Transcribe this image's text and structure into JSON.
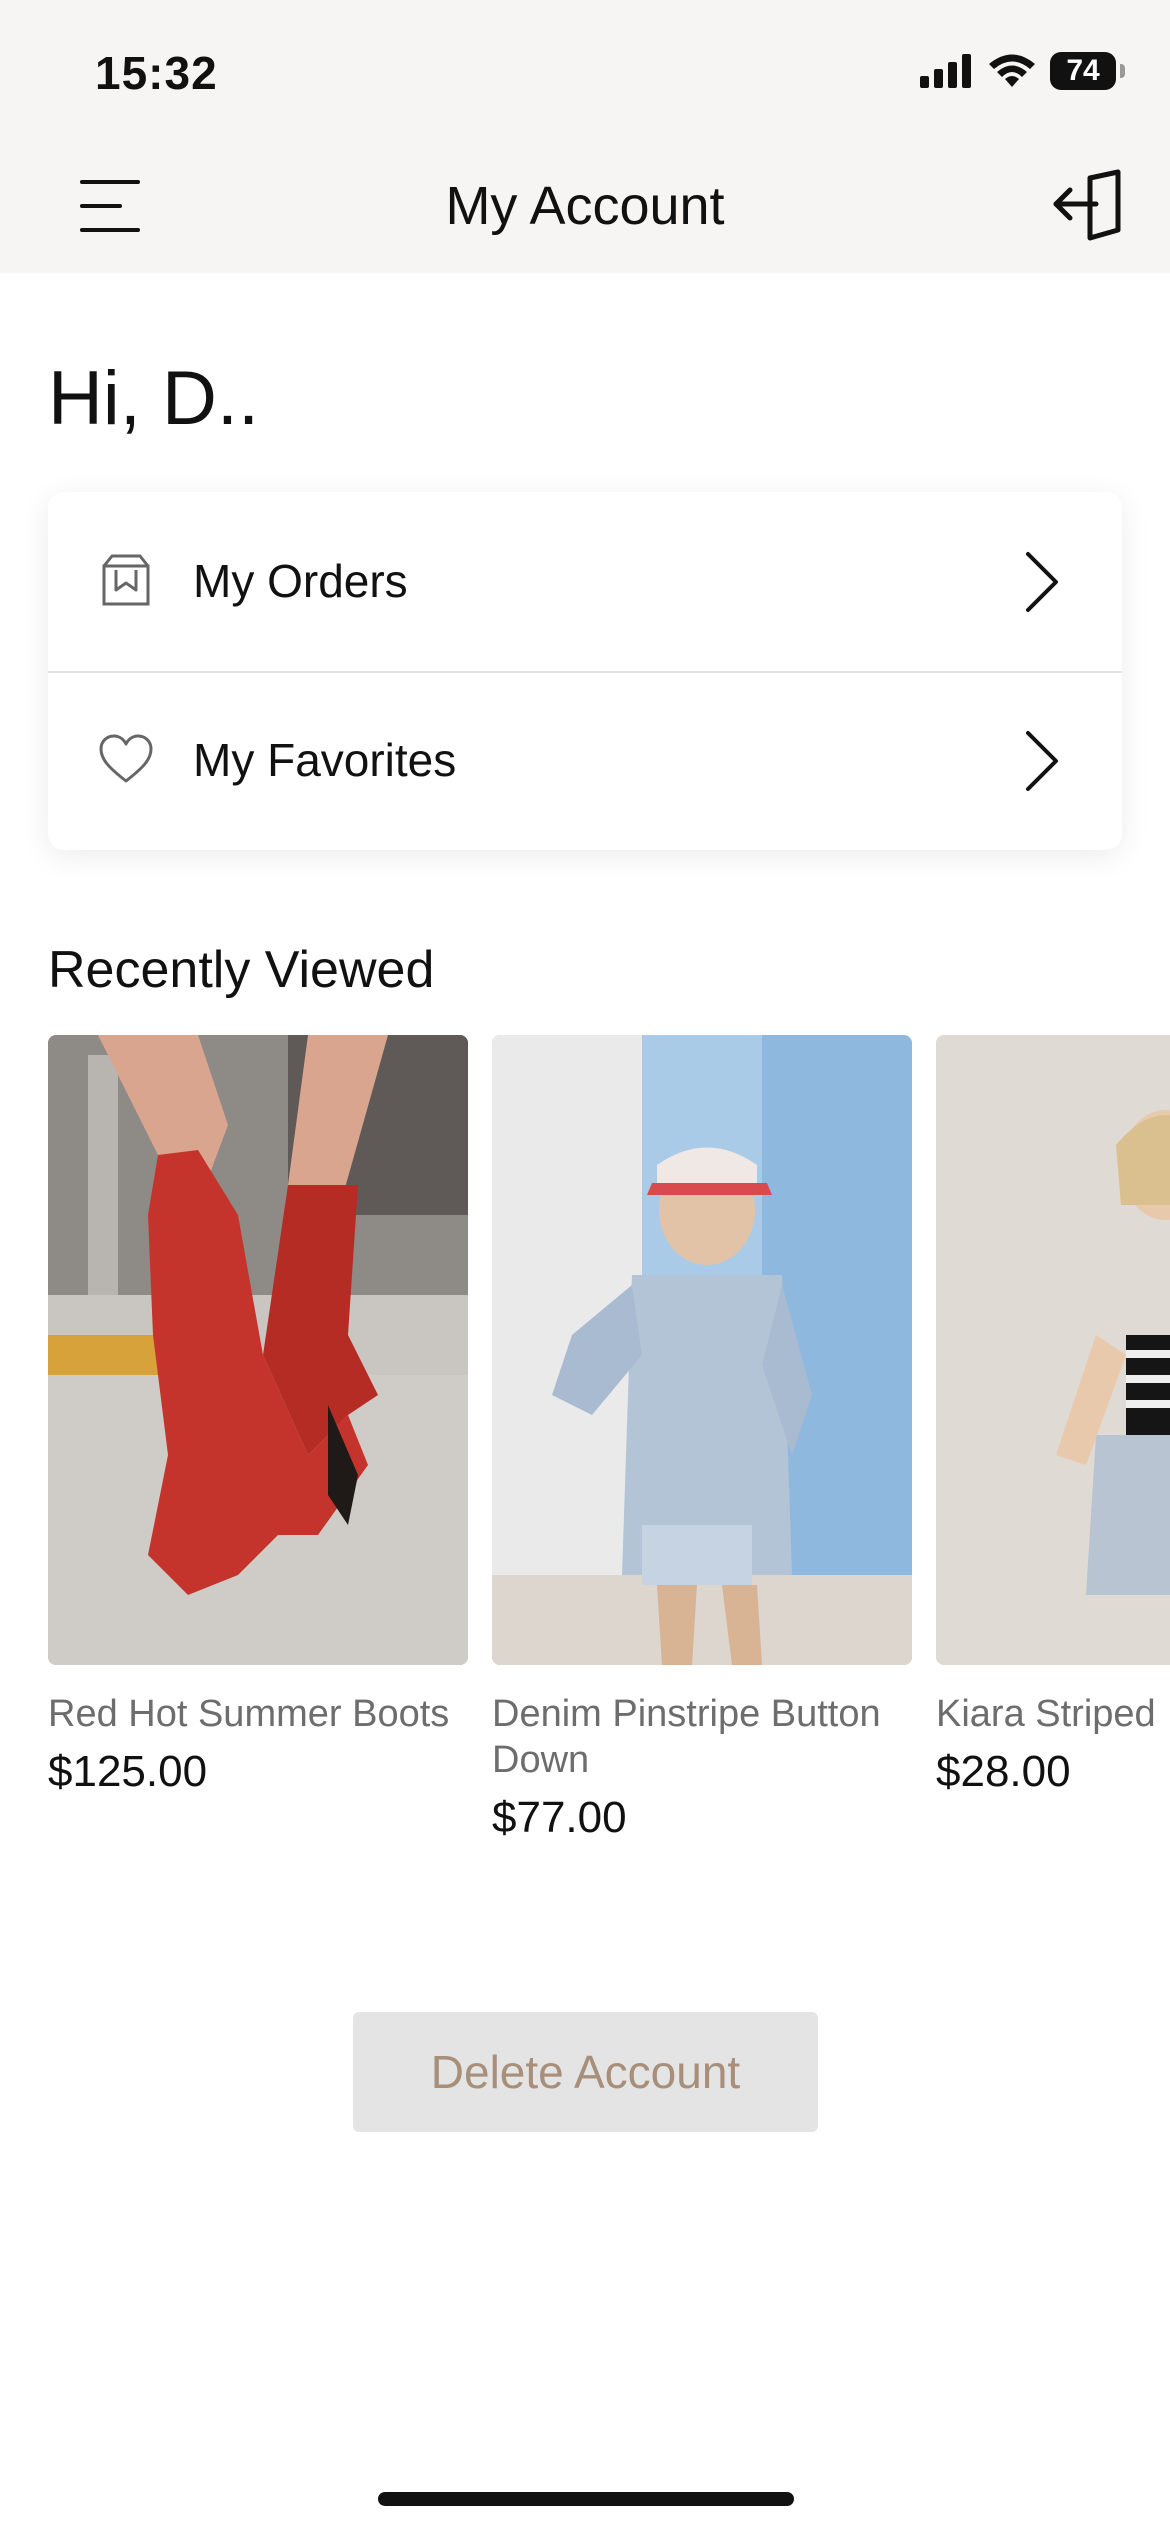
{
  "status_bar": {
    "time": "15:32",
    "battery": "74"
  },
  "header": {
    "title": "My Account",
    "menu_icon": "menu-icon",
    "logout_icon": "logout-icon"
  },
  "greeting": "Hi,  D..",
  "account_menu": {
    "items": [
      {
        "label": "My Orders",
        "icon": "orders-bag-icon"
      },
      {
        "label": "My Favorites",
        "icon": "heart-icon"
      }
    ]
  },
  "recently_viewed": {
    "title": "Recently Viewed",
    "products": [
      {
        "name": "Red Hot Summer Boots",
        "price": "$125.00"
      },
      {
        "name": "Denim Pinstripe Button Down",
        "price": "$77.00"
      },
      {
        "name": "Kiara Striped",
        "price": "$28.00"
      }
    ]
  },
  "delete_button": {
    "label": "Delete Account"
  },
  "colors": {
    "header_bg": "#f6f5f3",
    "delete_text": "#a88f7a",
    "delete_bg": "#e4e4e4"
  }
}
